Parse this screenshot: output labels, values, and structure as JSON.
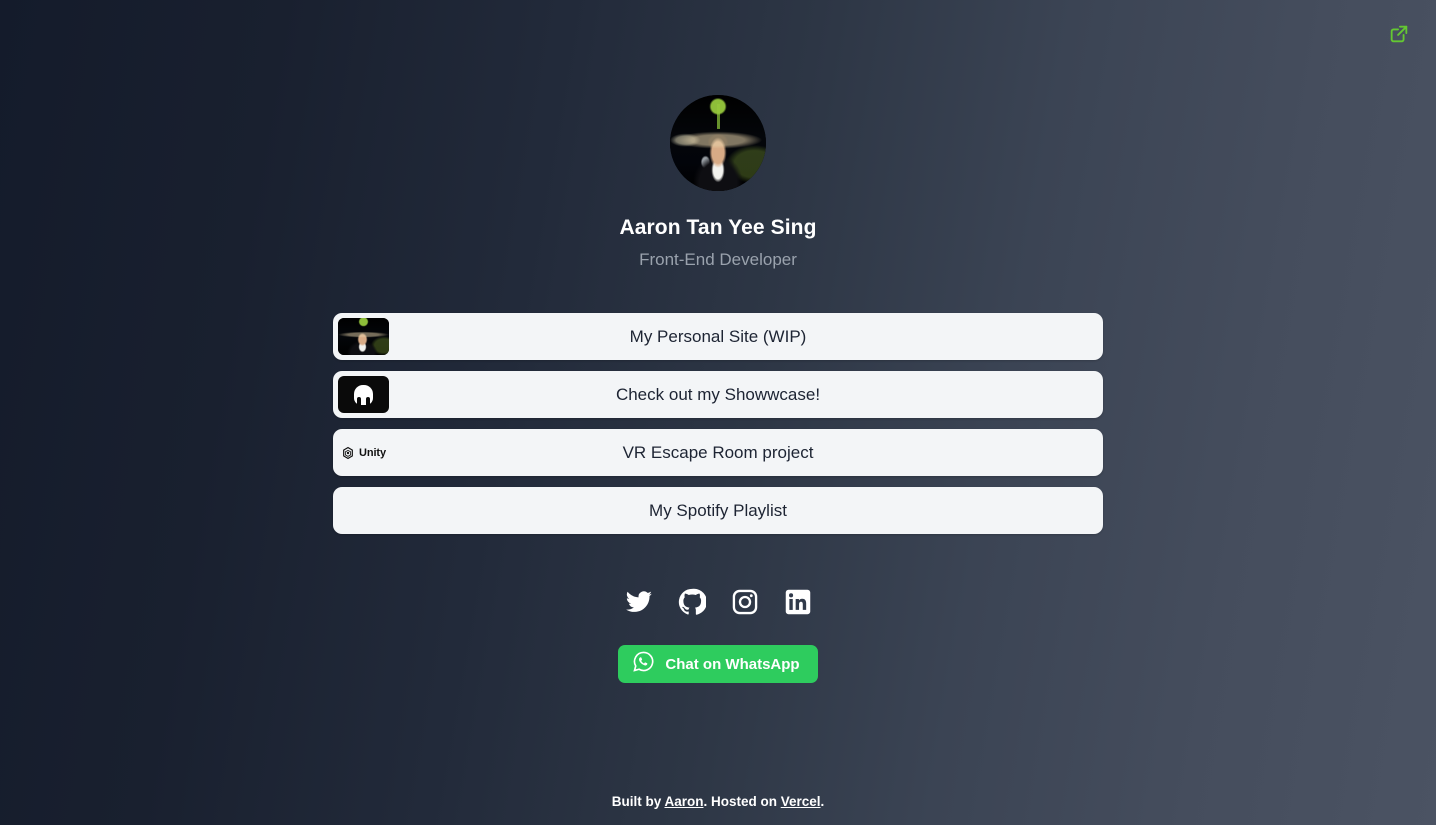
{
  "topbar": {
    "external_link_icon": "external-link-icon",
    "external_link_color": "#64c832"
  },
  "profile": {
    "avatar_alt": "avatar",
    "name": "Aaron Tan Yee Sing",
    "subtitle": "Front-End Developer"
  },
  "links": [
    {
      "label": "My Personal Site (WIP)",
      "icon": "personal-site-thumbnail",
      "has_thumb": true
    },
    {
      "label": "Check out my Showwcase!",
      "icon": "showwcase-logo",
      "has_thumb": true
    },
    {
      "label": "VR Escape Room project",
      "icon": "unity-logo",
      "unity_word": "Unity",
      "has_thumb": true
    },
    {
      "label": "My Spotify Playlist",
      "icon": "none",
      "has_thumb": false
    }
  ],
  "socials": [
    {
      "name": "twitter-icon",
      "label": "Twitter"
    },
    {
      "name": "github-icon",
      "label": "GitHub"
    },
    {
      "name": "instagram-icon",
      "label": "Instagram"
    },
    {
      "name": "linkedin-icon",
      "label": "LinkedIn"
    }
  ],
  "whatsapp": {
    "label": "Chat on WhatsApp",
    "icon": "whatsapp-icon",
    "color": "#2ecc5e"
  },
  "footer": {
    "built_by_text": "Built by ",
    "author_link": "Aaron",
    "hosted_text": ". Hosted on ",
    "host_link": "Vercel",
    "period": "."
  },
  "colors": {
    "bg_dark": "#141b2b",
    "bg_light": "#4b5363",
    "button_bg": "#f3f5f7",
    "button_text": "#1d2433",
    "subtitle": "#9aa2ad"
  }
}
